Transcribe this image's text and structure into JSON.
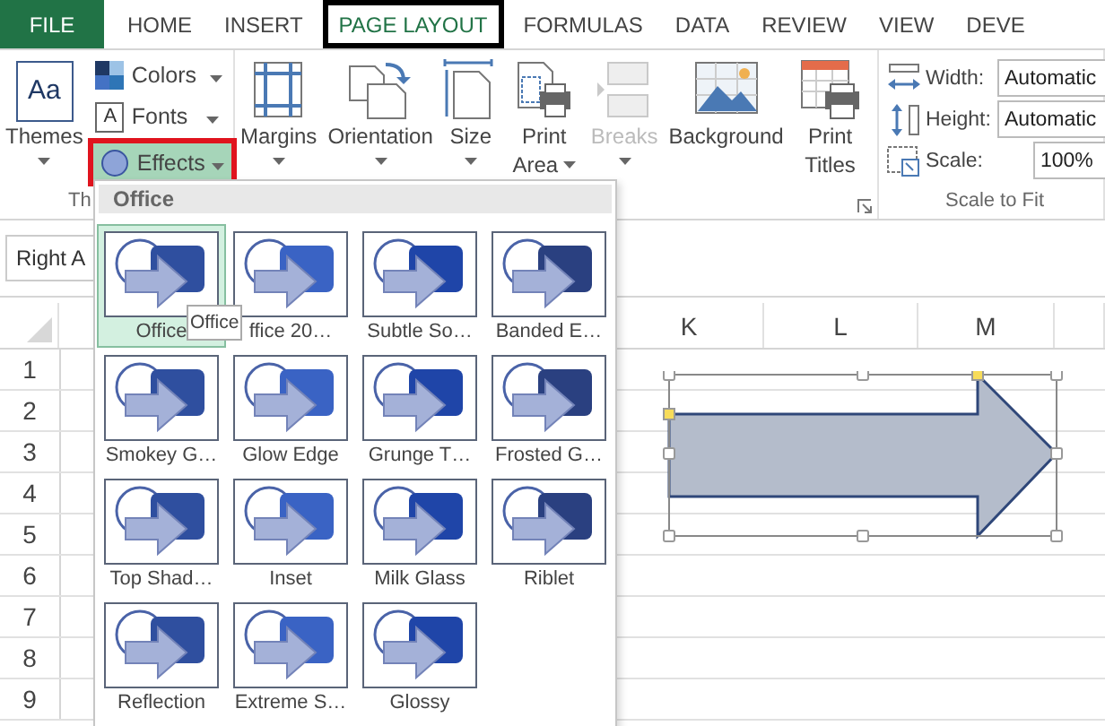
{
  "tabs": [
    {
      "label": "FILE",
      "kind": "file",
      "selected": false
    },
    {
      "label": "HOME",
      "kind": "tab",
      "selected": false
    },
    {
      "label": "INSERT",
      "kind": "tab",
      "selected": false
    },
    {
      "label": "PAGE LAYOUT",
      "kind": "tab",
      "selected": true
    },
    {
      "label": "FORMULAS",
      "kind": "tab",
      "selected": false
    },
    {
      "label": "DATA",
      "kind": "tab",
      "selected": false
    },
    {
      "label": "REVIEW",
      "kind": "tab",
      "selected": false
    },
    {
      "label": "VIEW",
      "kind": "tab",
      "selected": false
    },
    {
      "label": "DEVE",
      "kind": "tab",
      "selected": false
    }
  ],
  "themes_group": {
    "label": "Th",
    "themes_button": {
      "label": "Themes",
      "glyph": "Aa"
    },
    "small_buttons": [
      {
        "label": "Colors",
        "kind": "colors",
        "pressed": false
      },
      {
        "label": "Fonts",
        "kind": "fonts",
        "glyph": "A",
        "pressed": false
      },
      {
        "label": "Effects",
        "kind": "effects",
        "pressed": true
      }
    ]
  },
  "page_setup_group": {
    "buttons": [
      {
        "label": "Margins",
        "kind": "margins",
        "has_menu": true,
        "disabled": false
      },
      {
        "label": "Orientation",
        "kind": "orientation",
        "has_menu": true,
        "disabled": false
      },
      {
        "label": "Size",
        "kind": "size",
        "has_menu": true,
        "disabled": false
      },
      {
        "label": "Print Area",
        "kind": "print_area",
        "has_menu": true,
        "disabled": false
      },
      {
        "label": "Breaks",
        "kind": "breaks",
        "has_menu": true,
        "disabled": true
      },
      {
        "label": "Background",
        "kind": "background",
        "has_menu": false,
        "disabled": false
      },
      {
        "label": "Print Titles",
        "kind": "print_titles",
        "has_menu": false,
        "disabled": false
      }
    ]
  },
  "scale_group": {
    "label": "Scale to Fit",
    "fields": [
      {
        "label": "Width:",
        "kind": "width",
        "value": "Automatic"
      },
      {
        "label": "Height:",
        "kind": "height",
        "value": "Automatic"
      },
      {
        "label": "Scale:",
        "kind": "scale",
        "value": "100%"
      }
    ]
  },
  "name_box": {
    "value": "Right A"
  },
  "sheet": {
    "columns": [
      "K",
      "L",
      "M"
    ],
    "rows": [
      "1",
      "2",
      "3",
      "4",
      "5",
      "6",
      "7",
      "8",
      "9"
    ]
  },
  "effects_menu": {
    "header": "Office",
    "tooltip": "Office",
    "items": [
      {
        "label": "Office",
        "selected": true
      },
      {
        "label": "ffice 20…",
        "selected": false
      },
      {
        "label": "Subtle So…",
        "selected": false
      },
      {
        "label": "Banded E…",
        "selected": false
      },
      {
        "label": "Smokey G…",
        "selected": false
      },
      {
        "label": "Glow Edge",
        "selected": false
      },
      {
        "label": "Grunge T…",
        "selected": false
      },
      {
        "label": "Frosted G…",
        "selected": false
      },
      {
        "label": "Top Shad…",
        "selected": false
      },
      {
        "label": "Inset",
        "selected": false
      },
      {
        "label": "Milk Glass",
        "selected": false
      },
      {
        "label": "Riblet",
        "selected": false
      },
      {
        "label": "Reflection",
        "selected": false
      },
      {
        "label": "Extreme S…",
        "selected": false
      },
      {
        "label": "Glossy",
        "selected": false
      }
    ]
  }
}
